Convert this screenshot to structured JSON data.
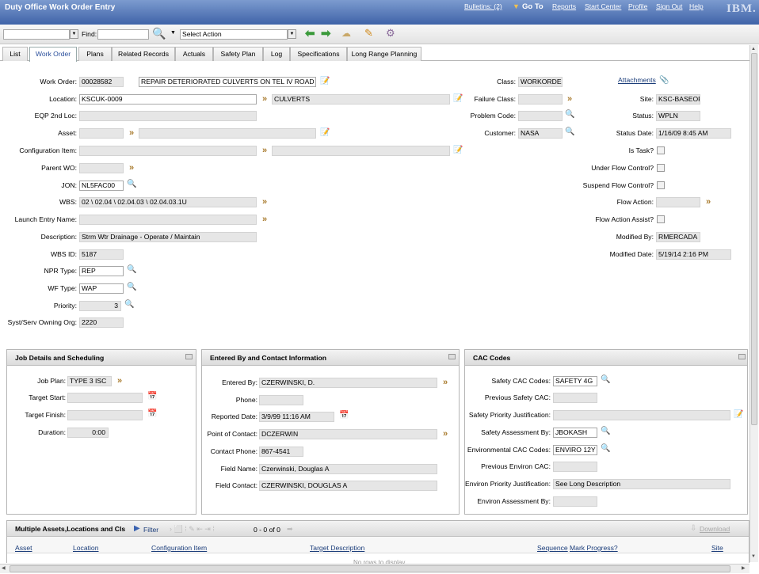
{
  "app": {
    "title": "Duty Office Work Order Entry",
    "logo": "IBM."
  },
  "topnav": {
    "bulletins": "Bulletins: (2)",
    "goto": "Go To",
    "reports": "Reports",
    "start_center": "Start Center",
    "profile": "Profile",
    "sign_out": "Sign Out",
    "help": "Help"
  },
  "toolbar": {
    "find_label": "Find:",
    "select_action": "Select Action"
  },
  "tabs": [
    "List",
    "Work Order",
    "Plans",
    "Related Records",
    "Actuals",
    "Safety Plan",
    "Log",
    "Specifications",
    "Long Range Planning"
  ],
  "main": {
    "left": {
      "work_order": {
        "label": "Work Order:",
        "value": "00028582",
        "desc": "REPAIR DETERIORATED CULVERTS ON TEL IV ROAD"
      },
      "location": {
        "label": "Location:",
        "value": "KSCUK-0009",
        "desc": "CULVERTS"
      },
      "eqp_2nd_loc": {
        "label": "EQP 2nd Loc:"
      },
      "asset": {
        "label": "Asset:"
      },
      "configuration_item": {
        "label": "Configuration Item:"
      },
      "parent_wo": {
        "label": "Parent WO:"
      },
      "jon": {
        "label": "JON:",
        "value": "NL5FAC00"
      },
      "wbs": {
        "label": "WBS:",
        "value": "02 \\ 02.04 \\ 02.04.03 \\ 02.04.03.1U"
      },
      "launch_entry_name": {
        "label": "Launch Entry Name:"
      },
      "description": {
        "label": "Description:",
        "value": "Strm Wtr Drainage - Operate / Maintain"
      },
      "wbs_id": {
        "label": "WBS ID:",
        "value": "5187"
      },
      "npr_type": {
        "label": "NPR Type:",
        "value": "REP"
      },
      "wf_type": {
        "label": "WF Type:",
        "value": "WAP"
      },
      "priority": {
        "label": "Priority:",
        "value": "3"
      },
      "owning_org": {
        "label": "Syst/Serv Owning Org:",
        "value": "2220"
      }
    },
    "middle": {
      "class": {
        "label": "Class:",
        "value": "WORKORDER"
      },
      "failure_class": {
        "label": "Failure Class:"
      },
      "problem_code": {
        "label": "Problem Code:"
      },
      "customer": {
        "label": "Customer:",
        "value": "NASA"
      }
    },
    "right": {
      "attachments": "Attachments",
      "site": {
        "label": "Site:",
        "value": "KSC-BASEOPS"
      },
      "status": {
        "label": "Status:",
        "value": "WPLN"
      },
      "status_date": {
        "label": "Status Date:",
        "value": "1/16/09 8:45 AM"
      },
      "is_task": {
        "label": "Is Task?"
      },
      "under_flow_control": {
        "label": "Under Flow Control?"
      },
      "suspend_flow_control": {
        "label": "Suspend Flow Control?"
      },
      "flow_action": {
        "label": "Flow Action:"
      },
      "flow_action_assist": {
        "label": "Flow Action Assist?"
      },
      "modified_by": {
        "label": "Modified By:",
        "value": "RMERCADA"
      },
      "modified_date": {
        "label": "Modified Date:",
        "value": "5/19/14 2:16 PM"
      }
    }
  },
  "job_details": {
    "title": "Job Details and Scheduling",
    "job_plan": {
      "label": "Job Plan:",
      "value": "TYPE 3 ISC"
    },
    "target_start": {
      "label": "Target Start:"
    },
    "target_finish": {
      "label": "Target Finish:"
    },
    "duration": {
      "label": "Duration:",
      "value": "0:00"
    }
  },
  "entered_by": {
    "title": "Entered By and Contact Information",
    "entered_by": {
      "label": "Entered By:",
      "value": "CZERWINSKI, D."
    },
    "phone": {
      "label": "Phone:"
    },
    "reported_date": {
      "label": "Reported Date:",
      "value": "3/9/99 11:16 AM"
    },
    "point_of_contact": {
      "label": "Point of Contact:",
      "value": "DCZERWIN"
    },
    "contact_phone": {
      "label": "Contact Phone:",
      "value": "867-4541"
    },
    "field_name": {
      "label": "Field Name:",
      "value": "Czerwinski, Douglas A"
    },
    "field_contact": {
      "label": "Field Contact:",
      "value": "CZERWINSKI, DOUGLAS A"
    }
  },
  "cac": {
    "title": "CAC Codes",
    "safety_cac": {
      "label": "Safety CAC Codes:",
      "value": "SAFETY 4G"
    },
    "prev_safety_cac": {
      "label": "Previous Safety CAC:"
    },
    "safety_priority_just": {
      "label": "Safety Priority Justification:"
    },
    "safety_assessment_by": {
      "label": "Safety Assessment By:",
      "value": "JBOKASH"
    },
    "env_cac": {
      "label": "Environmental CAC Codes:",
      "value": "ENVIRO 12Y"
    },
    "prev_env_cac": {
      "label": "Previous Environ CAC:"
    },
    "env_priority_just": {
      "label": "Environ Priority Justification:",
      "value": "See Long Description"
    },
    "env_assessment_by": {
      "label": "Environ Assessment By:"
    }
  },
  "multi": {
    "title": "Multiple Assets,Locations and CIs",
    "filter": "Filter",
    "count": "0 - 0 of 0",
    "download": "Download",
    "columns": [
      "Asset",
      "Location",
      "Configuration Item",
      "Target Description",
      "Sequence",
      "Mark Progress?",
      "Site"
    ],
    "empty": "No rows to display"
  },
  "colors": {
    "title_bar": "#4a6cb0",
    "tab_active_text": "#2a4f9c",
    "readonly_bg": "#e6e6e6",
    "chevron": "#a87a2c"
  }
}
